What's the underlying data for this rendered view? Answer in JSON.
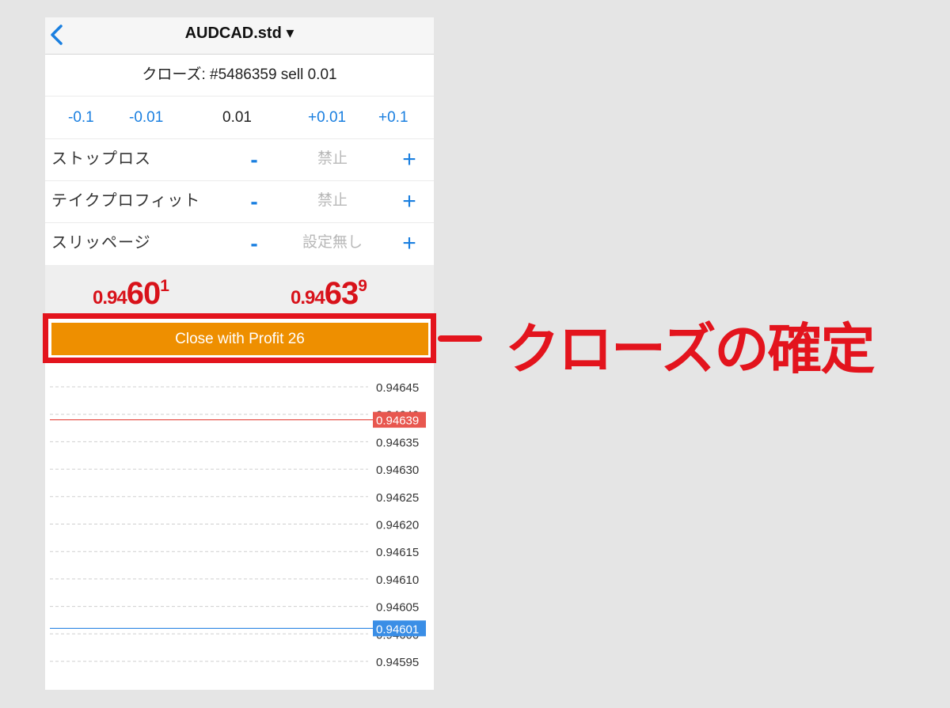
{
  "nav": {
    "title": "AUDCAD.std ▾",
    "back_icon": "chevron-left-icon"
  },
  "order": {
    "text": "クローズ: #5486359 sell 0.01"
  },
  "volume": {
    "minus_big": "-0.1",
    "minus_small": "-0.01",
    "value": "0.01",
    "plus_small": "+0.01",
    "plus_big": "+0.1"
  },
  "params": [
    {
      "label": "ストップロス",
      "minus": "-",
      "value": "禁止",
      "plus": "+"
    },
    {
      "label": "テイクプロフィット",
      "minus": "-",
      "value": "禁止",
      "plus": "+"
    },
    {
      "label": "スリッページ",
      "minus": "-",
      "value": "設定無し",
      "plus": "+"
    }
  ],
  "prices": {
    "bid": {
      "small": "0.94",
      "big": "60",
      "sup": "1"
    },
    "ask": {
      "small": "0.94",
      "big": "63",
      "sup": "9"
    }
  },
  "close_button": {
    "label": "Close with Profit 26"
  },
  "chart_data": {
    "type": "line",
    "y_ticks": [
      "0.94645",
      "0.94640",
      "0.94635",
      "0.94630",
      "0.94625",
      "0.94620",
      "0.94615",
      "0.94610",
      "0.94605",
      "0.94600",
      "0.94595"
    ],
    "ylim": [
      0.94595,
      0.94645
    ],
    "grid": true,
    "series": [
      {
        "label": "0.94639",
        "value": 0.94639,
        "color": "#e8574f"
      },
      {
        "label": "0.94601",
        "value": 0.94601,
        "color": "#3a8ee6"
      }
    ]
  },
  "annotation": {
    "text": "クローズの確定",
    "color": "#e3141d"
  }
}
